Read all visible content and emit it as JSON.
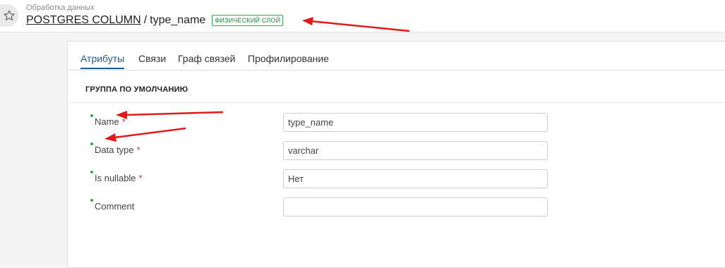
{
  "header": {
    "breadcrumb": "Обработка данных",
    "entity_type": "POSTGRES COLUMN",
    "separator": "/",
    "entity_name": "type_name",
    "layer_badge": "ФИЗИЧЕСКИЙ СЛОЙ",
    "favorite_icon": "star-icon"
  },
  "tabs": [
    {
      "label": "Атрибуты",
      "active": true
    },
    {
      "label": "Связи",
      "active": false
    },
    {
      "label": "Граф связей",
      "active": false
    },
    {
      "label": "Профилирование",
      "active": false
    }
  ],
  "group": {
    "title": "ГРУППА ПО УМОЛЧАНИЮ"
  },
  "fields": [
    {
      "label": "Name",
      "required_mark": "*",
      "value": "type_name"
    },
    {
      "label": "Data type",
      "required_mark": "*",
      "value": "varchar"
    },
    {
      "label": "Is nullable",
      "required_mark": "*",
      "value": "Нет"
    },
    {
      "label": "Comment",
      "required_mark": "",
      "value": ""
    }
  ],
  "colors": {
    "accent": "#1f5a93",
    "badge": "#1a8a3a",
    "required": "#c0392b",
    "dot": "#2fa84f",
    "annotation_arrow": "#e01b1b"
  }
}
